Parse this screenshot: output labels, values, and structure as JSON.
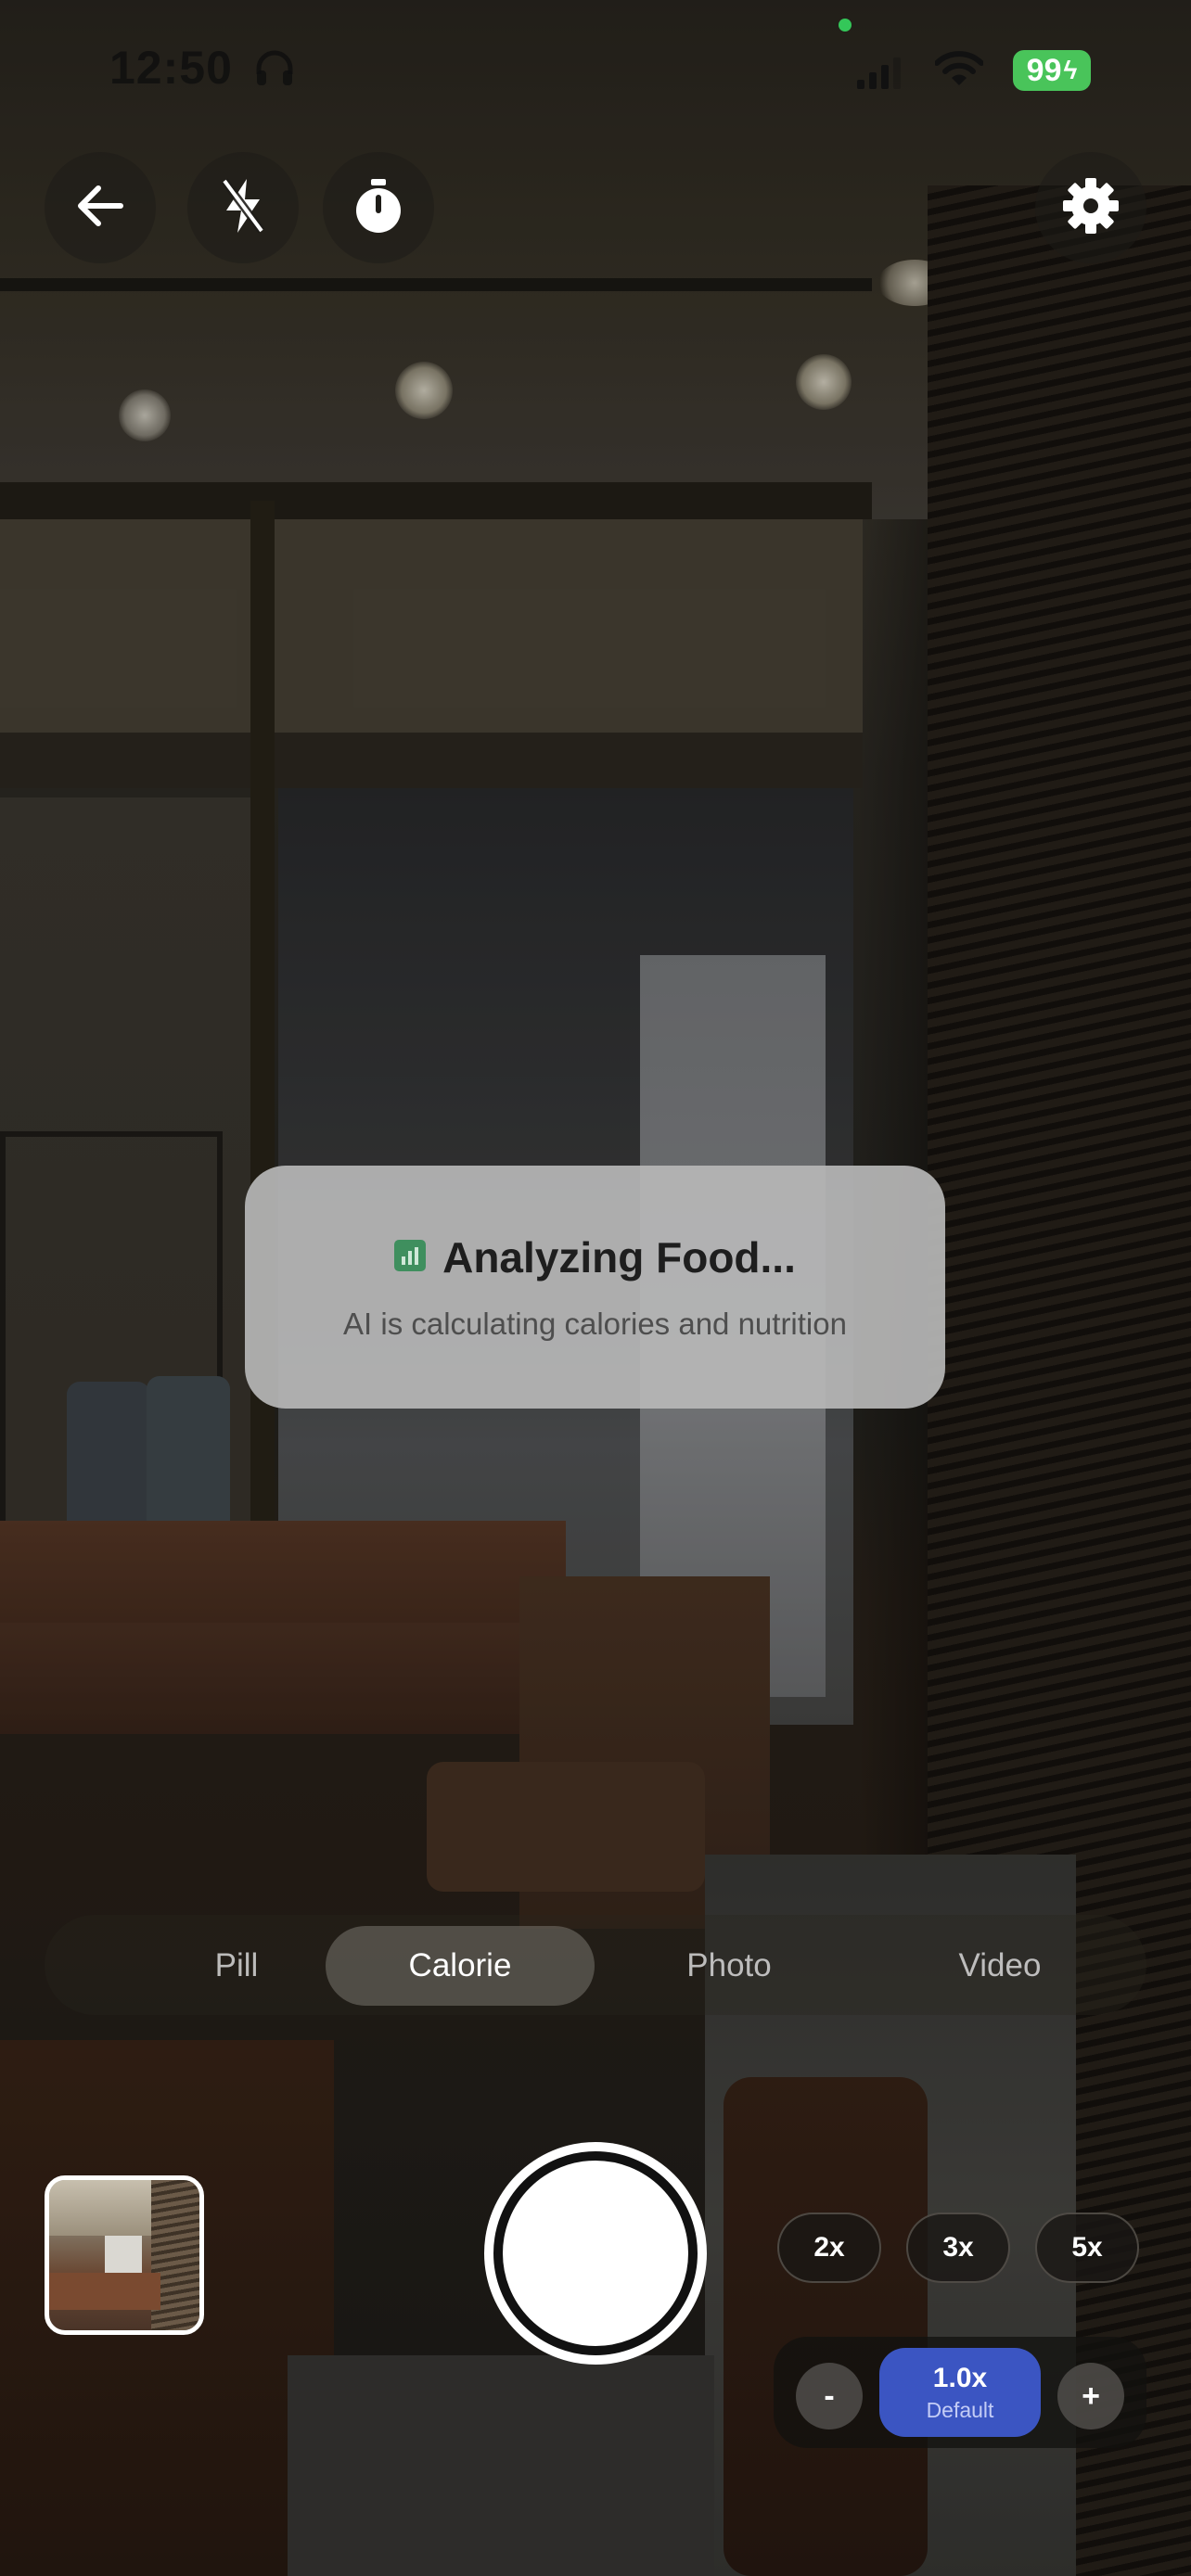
{
  "status_bar": {
    "time": "12:50",
    "battery": "99"
  },
  "toolbar": {
    "back_icon": "arrow-left-icon",
    "flash_icon": "flash-off-icon",
    "timer_icon": "timer-icon",
    "settings_icon": "gear-icon"
  },
  "toast": {
    "icon": "bar-chart-icon",
    "title": "Analyzing Food...",
    "subtitle": "AI is calculating calories and nutrition"
  },
  "modes": [
    {
      "label": "Pill"
    },
    {
      "label": "Calorie",
      "active": true
    },
    {
      "label": "Photo"
    },
    {
      "label": "Video"
    }
  ],
  "zoom": {
    "presets": [
      "2x",
      "3x",
      "5x"
    ],
    "current": "1.0x",
    "current_caption": "Default",
    "decrease": "-",
    "increase": "+"
  },
  "colors": {
    "accent": "#3b55c2",
    "battery": "#49c45a",
    "status_dot": "#34c759"
  }
}
